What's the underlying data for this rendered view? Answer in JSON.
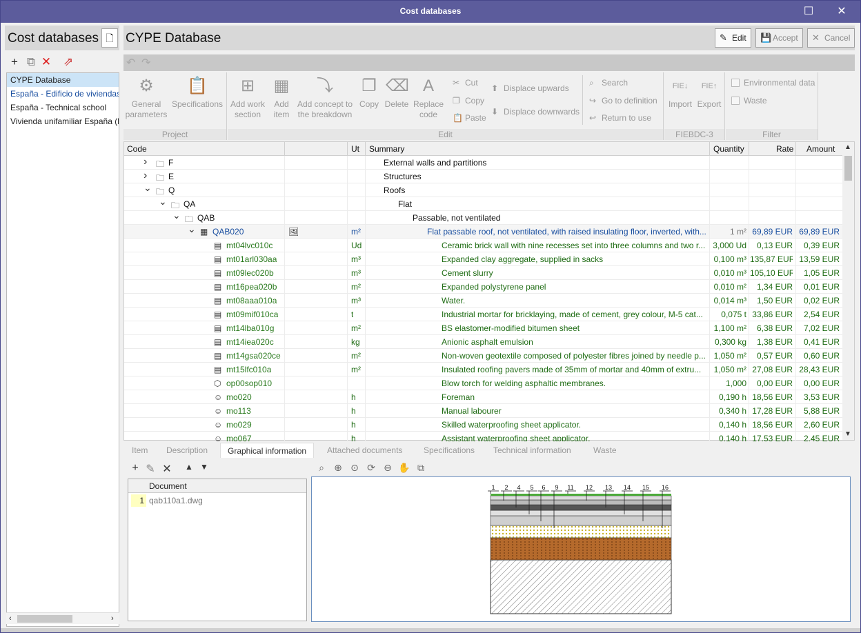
{
  "window": {
    "title": "Cost databases",
    "maximize_icon": "maximize-icon",
    "close_icon": "close-icon"
  },
  "left": {
    "title": "Cost databases",
    "databases": [
      {
        "label": "CYPE Database",
        "selected": true
      },
      {
        "label": "España - Edificio de viviendas"
      },
      {
        "label": "España - Technical school"
      },
      {
        "label": "Vivienda unifamiliar España (h"
      }
    ]
  },
  "header": {
    "title": "CYPE Database",
    "edit_label": "Edit",
    "accept_label": "Accept",
    "cancel_label": "Cancel"
  },
  "ribbon": {
    "project": {
      "label": "Project",
      "general_parameters": "General parameters",
      "specifications": "Specifications"
    },
    "edit": {
      "label": "Edit",
      "add_work_section": "Add work section",
      "add_item": "Add item",
      "add_concept": "Add concept to the breakdown",
      "copy_big": "Copy",
      "delete": "Delete",
      "replace_code": "Replace code",
      "cut": "Cut",
      "copy": "Copy",
      "paste": "Paste",
      "displace_up": "Displace upwards",
      "displace_down": "Displace downwards",
      "search": "Search",
      "go_to_definition": "Go to definition",
      "return_to_use": "Return to use"
    },
    "fiebdc": {
      "label": "FIEBDC-3",
      "import": "Import",
      "export": "Export"
    },
    "filter": {
      "label": "Filter",
      "environmental": "Environmental data",
      "waste": "Waste"
    }
  },
  "grid": {
    "columns": {
      "code": "Code",
      "ut": "Ut",
      "summary": "Summary",
      "quantity": "Quantity",
      "rate": "Rate",
      "amount": "Amount"
    },
    "rows": [
      {
        "code": "F",
        "ut": "",
        "summary": "External walls and partitions",
        "quantity": "",
        "rate": "",
        "amount": "",
        "level": 0,
        "type": "folder",
        "expander": "chevron-right",
        "style": "blk"
      },
      {
        "code": "E",
        "ut": "",
        "summary": "Structures",
        "quantity": "",
        "rate": "",
        "amount": "",
        "level": 0,
        "type": "folder",
        "expander": "chevron-right",
        "style": "blk"
      },
      {
        "code": "Q",
        "ut": "",
        "summary": "Roofs",
        "quantity": "",
        "rate": "",
        "amount": "",
        "level": 0,
        "type": "folder",
        "expander": "chevron-down",
        "style": "blk"
      },
      {
        "code": "QA",
        "ut": "",
        "summary": "Flat",
        "quantity": "",
        "rate": "",
        "amount": "",
        "level": 1,
        "type": "folder",
        "expander": "chevron-down",
        "style": "blk"
      },
      {
        "code": "QAB",
        "ut": "",
        "summary": "Passable, not ventilated",
        "quantity": "",
        "rate": "",
        "amount": "",
        "level": 2,
        "type": "folder",
        "expander": "chevron-down",
        "style": "blk"
      },
      {
        "code": "QAB020",
        "ut": "m²",
        "summary": "Flat passable roof, not ventilated, with raised insulating floor, inverted, with...",
        "quantity": "1 m²",
        "rate": "69,89 EUR",
        "amount": "69,89 EUR",
        "level": 3,
        "type": "item",
        "expander": "chevron-down",
        "style": "blue",
        "has_image": true
      },
      {
        "code": "mt04lvc010c",
        "ut": "Ud",
        "summary": "Ceramic brick wall with nine recesses set into three columns and two r...",
        "quantity": "3,000 Ud",
        "rate": "0,13 EUR",
        "amount": "0,39 EUR",
        "level": 4,
        "type": "material",
        "style": "grn"
      },
      {
        "code": "mt01arl030aa",
        "ut": "m³",
        "summary": "Expanded clay aggregate, supplied in sacks",
        "quantity": "0,100 m³",
        "rate": "135,87 EUR",
        "amount": "13,59 EUR",
        "level": 4,
        "type": "material",
        "style": "grn"
      },
      {
        "code": "mt09lec020b",
        "ut": "m³",
        "summary": "Cement slurry",
        "quantity": "0,010 m³",
        "rate": "105,10 EUR",
        "amount": "1,05 EUR",
        "level": 4,
        "type": "material",
        "style": "grn"
      },
      {
        "code": "mt16pea020b",
        "ut": "m²",
        "summary": "Expanded polystyrene panel",
        "quantity": "0,010 m²",
        "rate": "1,34 EUR",
        "amount": "0,01 EUR",
        "level": 4,
        "type": "material",
        "style": "grn"
      },
      {
        "code": "mt08aaa010a",
        "ut": "m³",
        "summary": "Water.",
        "quantity": "0,014 m³",
        "rate": "1,50 EUR",
        "amount": "0,02 EUR",
        "level": 4,
        "type": "material",
        "style": "grn"
      },
      {
        "code": "mt09mif010ca",
        "ut": "t",
        "summary": "Industrial mortar for bricklaying, made of cement, grey colour, M-5 cat...",
        "quantity": "0,075 t",
        "rate": "33,86 EUR",
        "amount": "2,54 EUR",
        "level": 4,
        "type": "material",
        "style": "grn"
      },
      {
        "code": "mt14lba010g",
        "ut": "m²",
        "summary": "BS elastomer-modified  bitumen sheet",
        "quantity": "1,100 m²",
        "rate": "6,38 EUR",
        "amount": "7,02 EUR",
        "level": 4,
        "type": "material",
        "style": "grn"
      },
      {
        "code": "mt14iea020c",
        "ut": "kg",
        "summary": "Anionic asphalt emulsion",
        "quantity": "0,300 kg",
        "rate": "1,38 EUR",
        "amount": "0,41 EUR",
        "level": 4,
        "type": "material",
        "style": "grn"
      },
      {
        "code": "mt14gsa020ce",
        "ut": "m²",
        "summary": "Non-woven geotextile composed of polyester fibres joined by needle p...",
        "quantity": "1,050 m²",
        "rate": "0,57 EUR",
        "amount": "0,60 EUR",
        "level": 4,
        "type": "material",
        "style": "grn"
      },
      {
        "code": "mt15lfc010a",
        "ut": "m²",
        "summary": "Insulated roofing pavers made of 35mm of mortar and 40mm of extru...",
        "quantity": "1,050 m²",
        "rate": "27,08 EUR",
        "amount": "28,43 EUR",
        "level": 4,
        "type": "material",
        "style": "grn"
      },
      {
        "code": "op00sop010",
        "ut": "",
        "summary": "Blow torch for welding asphaltic membranes.",
        "quantity": "1,000",
        "rate": "0,00 EUR",
        "amount": "0,00 EUR",
        "level": 4,
        "type": "equipment",
        "style": "grn"
      },
      {
        "code": "mo020",
        "ut": "h",
        "summary": "Foreman",
        "quantity": "0,190 h",
        "rate": "18,56 EUR",
        "amount": "3,53 EUR",
        "level": 4,
        "type": "labour",
        "style": "grn"
      },
      {
        "code": "mo113",
        "ut": "h",
        "summary": "Manual labourer",
        "quantity": "0,340 h",
        "rate": "17,28 EUR",
        "amount": "5,88 EUR",
        "level": 4,
        "type": "labour",
        "style": "grn"
      },
      {
        "code": "mo029",
        "ut": "h",
        "summary": "Skilled waterproofing sheet applicator.",
        "quantity": "0,140 h",
        "rate": "18,56 EUR",
        "amount": "2,60 EUR",
        "level": 4,
        "type": "labour",
        "style": "grn"
      },
      {
        "code": "mo067",
        "ut": "h",
        "summary": "Assistant waterproofing sheet applicator.",
        "quantity": "0,140 h",
        "rate": "17,53 EUR",
        "amount": "2,45 EUR",
        "level": 4,
        "type": "labour",
        "style": "grn"
      }
    ]
  },
  "tabs": [
    {
      "label": "Item"
    },
    {
      "label": "Description"
    },
    {
      "label": "Graphical information",
      "active": true
    },
    {
      "label": "Attached documents"
    },
    {
      "label": "Specifications"
    },
    {
      "label": "Technical information"
    },
    {
      "label": "Waste"
    }
  ],
  "documents": {
    "header": "Document",
    "rows": [
      {
        "index": "1",
        "name": "qab110a1.dwg"
      }
    ]
  },
  "drawing": {
    "labels": [
      "1",
      "2",
      "4",
      "5",
      "6",
      "9",
      "11",
      "12",
      "13",
      "14",
      "15",
      "16"
    ]
  }
}
